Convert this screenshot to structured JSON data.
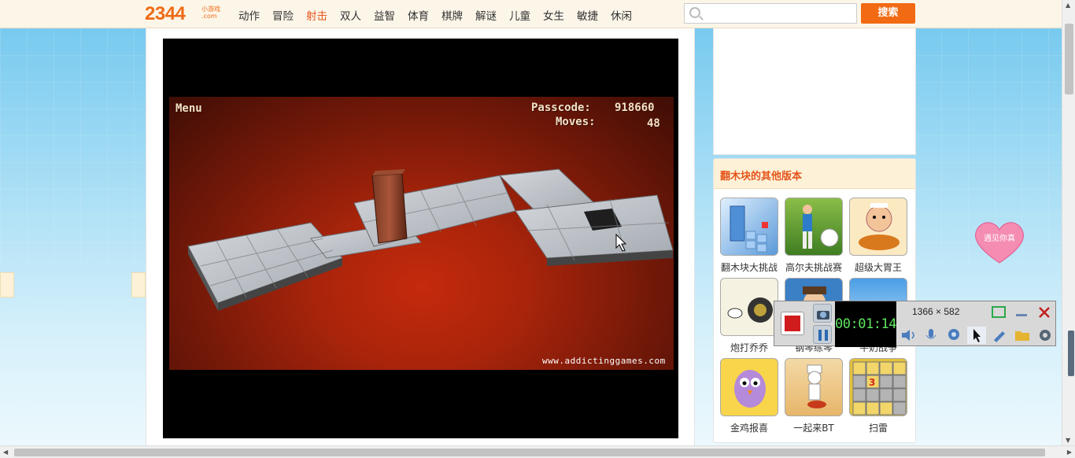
{
  "site": {
    "logo": "2344",
    "logo_sub_top": "小游戏",
    "logo_sub_bottom": ".com",
    "nav": [
      "动作",
      "冒险",
      "射击",
      "双人",
      "益智",
      "体育",
      "棋牌",
      "解谜",
      "儿童",
      "女生",
      "敏捷",
      "休闲"
    ],
    "active_nav": "射击",
    "search_placeholder": "",
    "search_button": "搜索"
  },
  "game": {
    "menu_label": "Menu",
    "passcode_label": "Passcode:",
    "passcode_value": "918660",
    "moves_label": "Moves:",
    "moves_value": "48",
    "url": "www.addictinggames.com"
  },
  "sidebar": {
    "title": "翻木块的其他版本",
    "games": [
      {
        "label": "翻木块大挑战",
        "icon": "blocks-icon"
      },
      {
        "label": "高尔夫挑战赛",
        "icon": "golf-icon"
      },
      {
        "label": "超级大胃王",
        "icon": "eater-icon"
      },
      {
        "label": "炮打乔乔",
        "icon": "cannon-icon"
      },
      {
        "label": "钢琴练琴",
        "icon": "person-icon"
      },
      {
        "label": "牛奶战争",
        "icon": "sky-icon"
      },
      {
        "label": "金鸡报喜",
        "icon": "chicken-icon"
      },
      {
        "label": "一起来BT",
        "icon": "chef-icon"
      },
      {
        "label": "扫雷",
        "icon": "minesweeper-icon"
      }
    ]
  },
  "ad": {
    "text": "遇见你真"
  },
  "recorder": {
    "time": "00:01:14",
    "dimensions": "1366 × 582",
    "buttons": [
      "stop",
      "camera",
      "pause",
      "audio",
      "mic",
      "webcam",
      "cursor",
      "pen",
      "folder",
      "settings",
      "window",
      "minimize",
      "close"
    ]
  }
}
